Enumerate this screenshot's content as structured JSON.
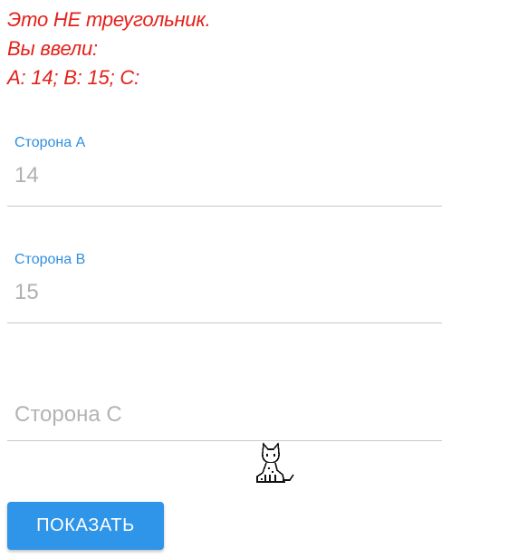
{
  "result": {
    "line1": "Это НЕ треугольник.",
    "line2": "Вы ввели:",
    "line3": "A: 14; B: 15; C:",
    "color": "#e5201a"
  },
  "form": {
    "side_a": {
      "label": "Сторона A",
      "value": "14"
    },
    "side_b": {
      "label": "Сторона B",
      "value": "15"
    },
    "side_c": {
      "placeholder": "Сторона C",
      "value": ""
    }
  },
  "cat": {
    "icon": "pixel-cat-icon"
  },
  "button": {
    "label": "ПОКАЗАТЬ",
    "color": "#2f95e9"
  },
  "colors": {
    "label": "#2f8fe0",
    "input_text": "#b0b0b0",
    "underline": "#c9c9c9"
  }
}
